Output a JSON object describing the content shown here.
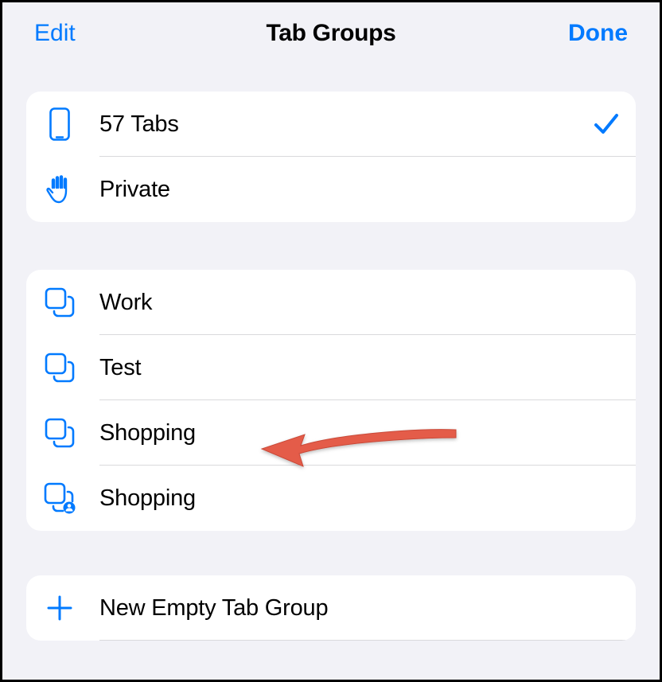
{
  "header": {
    "edit_label": "Edit",
    "title": "Tab Groups",
    "done_label": "Done"
  },
  "colors": {
    "accent": "#007aff",
    "annotation": "#e45c4a"
  },
  "section1": {
    "items": [
      {
        "icon": "phone-icon",
        "label": "57 Tabs",
        "selected": true
      },
      {
        "icon": "hand-icon",
        "label": "Private",
        "selected": false
      }
    ]
  },
  "section2": {
    "items": [
      {
        "icon": "group-icon",
        "label": "Work"
      },
      {
        "icon": "group-icon",
        "label": "Test"
      },
      {
        "icon": "group-icon",
        "label": "Shopping"
      },
      {
        "icon": "group-shared-icon",
        "label": "Shopping"
      }
    ]
  },
  "section3": {
    "items": [
      {
        "icon": "plus-icon",
        "label": "New Empty Tab Group"
      }
    ]
  },
  "annotation": {
    "points_to": "section2.items.2"
  }
}
